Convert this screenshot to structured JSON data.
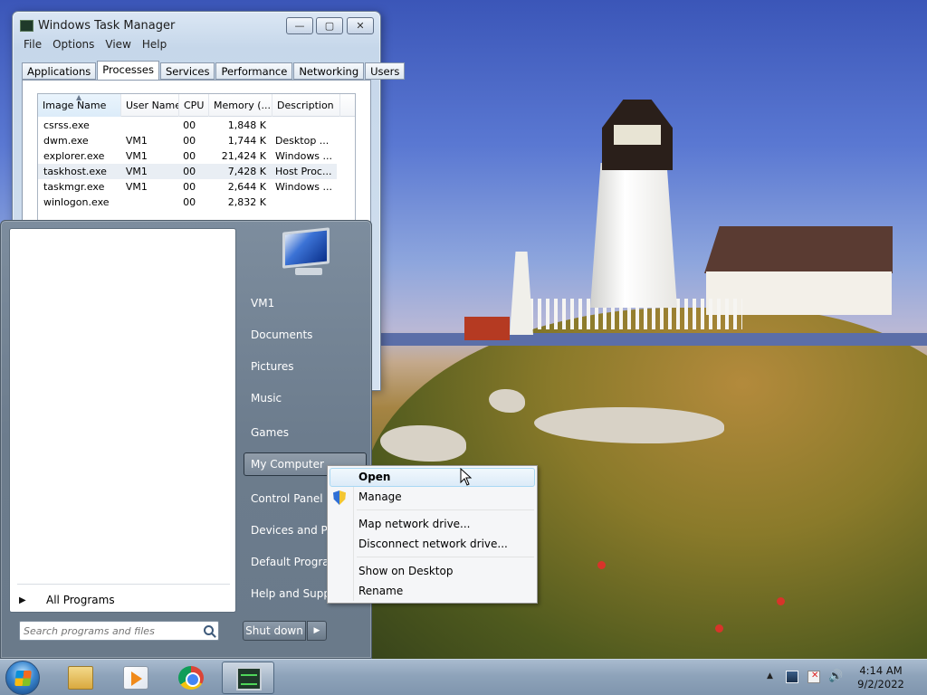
{
  "task_manager": {
    "title": "Windows Task Manager",
    "caption_buttons": {
      "minimize": "—",
      "maximize": "▢",
      "close": "✕"
    },
    "menu": [
      "File",
      "Options",
      "View",
      "Help"
    ],
    "tabs": [
      "Applications",
      "Processes",
      "Services",
      "Performance",
      "Networking",
      "Users"
    ],
    "active_tab": "Processes",
    "columns": [
      "Image Name",
      "User Name",
      "CPU",
      "Memory (...",
      "Description"
    ],
    "sort_indicator": "▲",
    "rows": [
      {
        "image": "csrss.exe",
        "user": "",
        "cpu": "00",
        "memory": "1,848 K",
        "description": ""
      },
      {
        "image": "dwm.exe",
        "user": "VM1",
        "cpu": "00",
        "memory": "1,744 K",
        "description": "Desktop ..."
      },
      {
        "image": "explorer.exe",
        "user": "VM1",
        "cpu": "00",
        "memory": "21,424 K",
        "description": "Windows ..."
      },
      {
        "image": "taskhost.exe",
        "user": "VM1",
        "cpu": "00",
        "memory": "7,428 K",
        "description": "Host Proc..."
      },
      {
        "image": "taskmgr.exe",
        "user": "VM1",
        "cpu": "00",
        "memory": "2,644 K",
        "description": "Windows ..."
      },
      {
        "image": "winlogon.exe",
        "user": "",
        "cpu": "00",
        "memory": "2,832 K",
        "description": ""
      }
    ],
    "selected_row": "taskhost.exe"
  },
  "start_menu": {
    "right_items": [
      "VM1",
      "Documents",
      "Pictures",
      "Music",
      "Games",
      "My Computer",
      "Control Panel",
      "Devices and Printers",
      "Default Programs",
      "Help and Support"
    ],
    "hovered_item": "My Computer",
    "all_programs_label": "All Programs",
    "all_programs_arrow": "▶",
    "search_placeholder": "Search programs and files",
    "shutdown_label": "Shut down",
    "shutdown_arrow": "▶"
  },
  "context_menu": {
    "items": [
      {
        "label": "Open",
        "bold": true
      },
      {
        "label": "Manage",
        "icon": "shield-icon"
      },
      {
        "label": "Map network drive..."
      },
      {
        "label": "Disconnect network drive..."
      },
      {
        "label": "Show on Desktop"
      },
      {
        "label": "Rename"
      }
    ],
    "hovered_item": "Open"
  },
  "taskbar": {
    "pinned": [
      "start-orb",
      "windows-explorer-icon",
      "media-player-icon",
      "chrome-icon",
      "task-manager-icon"
    ],
    "active_app": "task-manager-icon",
    "tray_arrow": "▲",
    "volume_glyph": "🔊",
    "clock_time": "4:14 AM",
    "clock_date": "9/2/2022"
  }
}
